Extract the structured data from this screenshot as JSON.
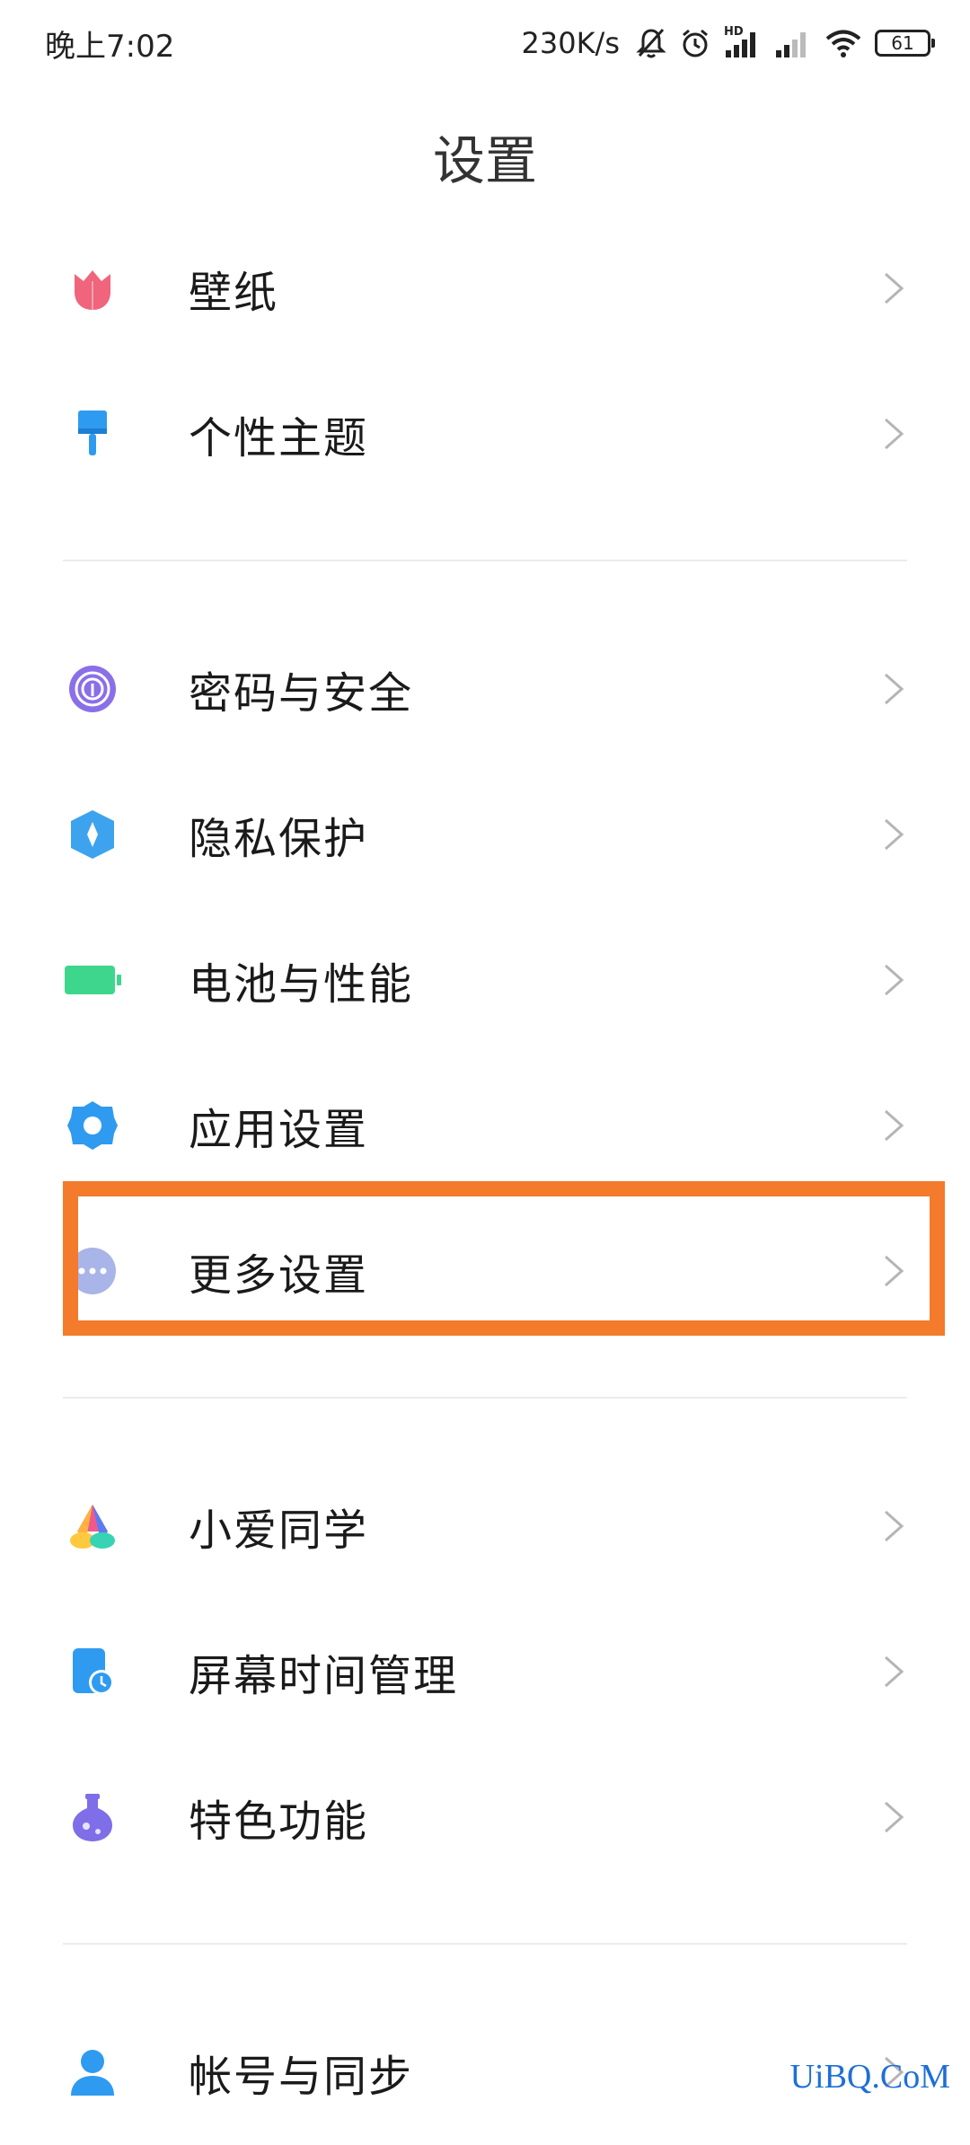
{
  "status_bar": {
    "time": "晚上7:02",
    "speed": "230K/s",
    "hd": "HD",
    "battery": "61"
  },
  "title": "设置",
  "items": [
    {
      "label": "壁纸",
      "icon": "wallpaper-icon"
    },
    {
      "label": "个性主题",
      "icon": "theme-brush-icon"
    },
    {
      "label": "密码与安全",
      "icon": "fingerprint-icon"
    },
    {
      "label": "隐私保护",
      "icon": "privacy-shield-icon"
    },
    {
      "label": "电池与性能",
      "icon": "battery-icon"
    },
    {
      "label": "应用设置",
      "icon": "app-gear-icon"
    },
    {
      "label": "更多设置",
      "icon": "more-dots-icon"
    },
    {
      "label": "小爱同学",
      "icon": "xiaoai-icon"
    },
    {
      "label": "屏幕时间管理",
      "icon": "screen-time-icon"
    },
    {
      "label": "特色功能",
      "icon": "flask-icon"
    },
    {
      "label": "帐号与同步",
      "icon": "account-icon"
    }
  ],
  "colors": {
    "highlight": "#f47a2c",
    "wallpaper": "#f0647c",
    "theme": "#2f9bf0",
    "fingerprint": "#8a6fe8",
    "privacy": "#3da3ee",
    "battery": "#3dd68c",
    "app": "#2f9bf0",
    "more": "#a9b4e8",
    "flask": "#7e6ee8",
    "account": "#2f9bf0"
  },
  "watermark": "UiBQ.CoM"
}
